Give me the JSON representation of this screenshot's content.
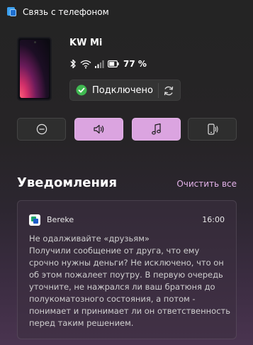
{
  "window": {
    "title": "Связь с телефоном"
  },
  "device": {
    "name": "KW Mi",
    "battery_percent": "77 %",
    "connection_status": "Подключено"
  },
  "controls": [
    {
      "name": "do-not-disturb-button",
      "icon": "minus-circle-icon",
      "active": false
    },
    {
      "name": "volume-button",
      "icon": "speaker-icon",
      "active": true
    },
    {
      "name": "music-button",
      "icon": "music-note-icon",
      "active": true
    },
    {
      "name": "ring-phone-button",
      "icon": "phone-ring-icon",
      "active": false
    }
  ],
  "notifications": {
    "title": "Уведомления",
    "clear_all_label": "Очистить все",
    "items": [
      {
        "app": "Bereke",
        "time": "16:00",
        "title": "Не одалживайте «друзьям»",
        "text": "Получили сообщение от друга, что ему срочно нужны деньги? Не исключено, что он об этом пожалеет поутру. В первую очередь уточните, не нажрался ли ваш братюня до полукоматозного состояния, а потом - понимает и принимает ли он ответственность перед таким решением."
      }
    ]
  },
  "colors": {
    "accent": "#dba4e0",
    "link": "#e4b3ea",
    "connected_green": "#3fb950"
  }
}
